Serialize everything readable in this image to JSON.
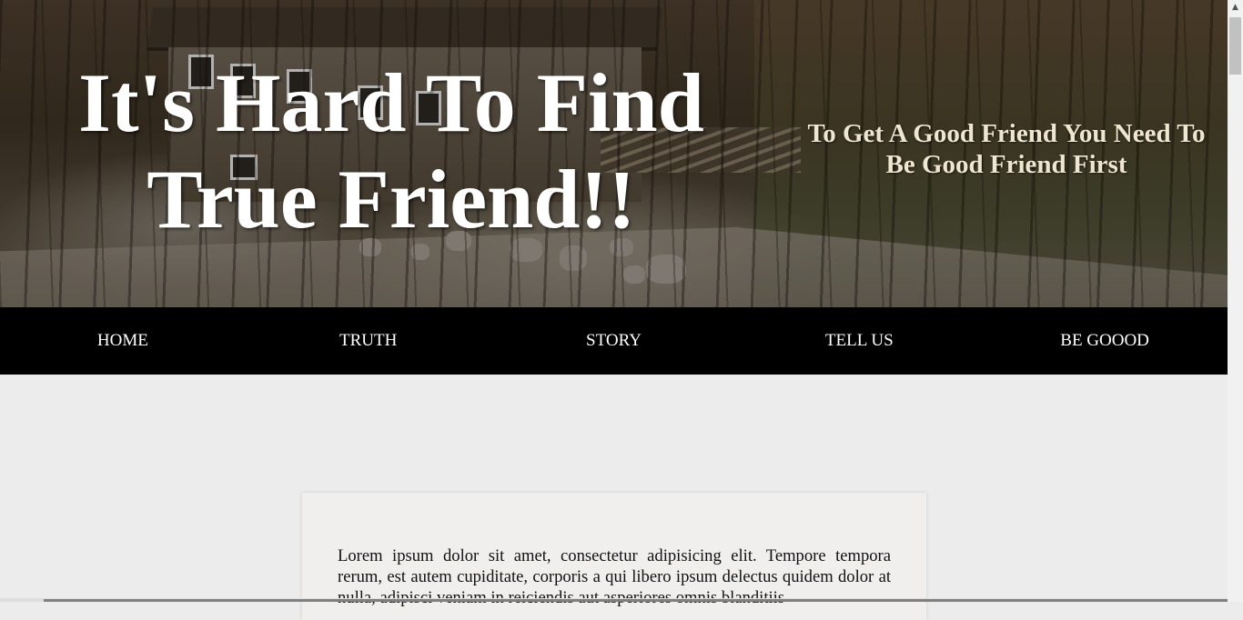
{
  "hero": {
    "title": "It's Hard To Find True Friend!!",
    "subtitle": "To Get A Good Friend You Need To Be Good Friend First"
  },
  "nav": {
    "items": [
      {
        "label": "HOME"
      },
      {
        "label": "TRUTH"
      },
      {
        "label": "STORY"
      },
      {
        "label": "TELL US"
      },
      {
        "label": "BE GOOOD"
      }
    ]
  },
  "content": {
    "paragraph": "Lorem ipsum dolor sit amet, consectetur adipisicing elit. Tempore tempora rerum, est autem cupiditate, corporis a qui libero ipsum delectus quidem dolor at nulla, adipisci veniam in reiciendis aut asperiores omnis blanditiis"
  },
  "colors": {
    "nav_background": "#000000",
    "nav_text": "#ffffff",
    "page_background": "#ececec",
    "card_background": "#f1eeee"
  },
  "icons": {
    "scroll_up": "scroll-up-arrow-icon"
  }
}
